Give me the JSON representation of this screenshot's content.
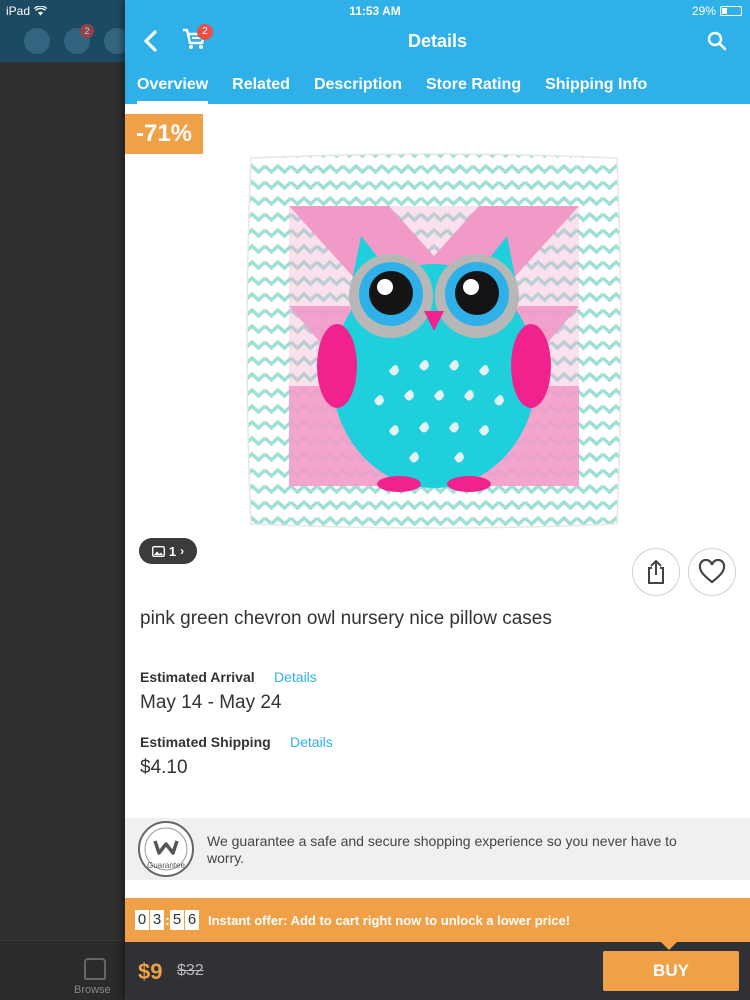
{
  "status_bar": {
    "device": "iPad",
    "time": "11:53 AM",
    "battery": "29%",
    "battery_level": 0.29
  },
  "background_app": {
    "cart_badge": "2",
    "nav_label": "Browse"
  },
  "header": {
    "title": "Details",
    "cart_badge": "2",
    "back_icon": "back-icon",
    "cart_icon": "cart-icon",
    "search_icon": "search-icon"
  },
  "tabs": [
    {
      "label": "Overview",
      "active": true
    },
    {
      "label": "Related",
      "active": false
    },
    {
      "label": "Description",
      "active": false
    },
    {
      "label": "Store Rating",
      "active": false
    },
    {
      "label": "Shipping Info",
      "active": false
    }
  ],
  "product": {
    "discount": "-71%",
    "image_count": "1",
    "title": "pink green chevron owl nursery nice pillow cases",
    "estimated_arrival": {
      "label": "Estimated Arrival",
      "link": "Details",
      "value": "May 14 - May 24"
    },
    "estimated_shipping": {
      "label": "Estimated Shipping",
      "link": "Details",
      "value": "$4.10"
    }
  },
  "guarantee": {
    "seal_text": "Guarantee",
    "text": "We guarantee a safe and secure shopping experience so you never have to worry."
  },
  "offer": {
    "timer": [
      "0",
      "3",
      "5",
      "6"
    ],
    "text": "Instant offer: Add to cart right now to unlock a lower price!"
  },
  "bottom": {
    "price": "$9",
    "old_price": "$32",
    "buy_label": "BUY"
  },
  "colors": {
    "header_blue": "#2fb0e8",
    "accent_orange": "#f0a046",
    "badge_red": "#e55048",
    "dark_bar": "#2f3135"
  }
}
